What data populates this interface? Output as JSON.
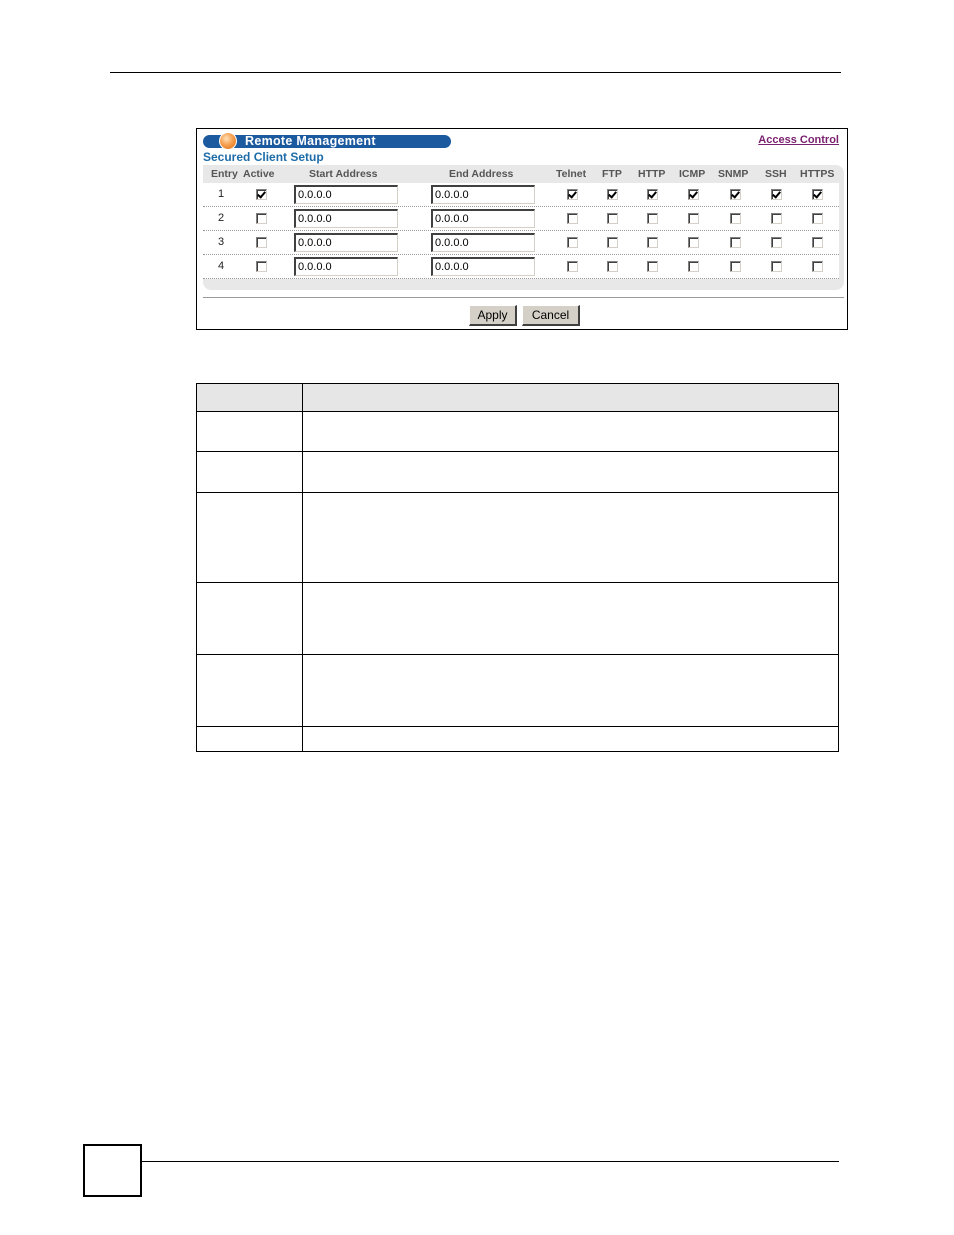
{
  "panel": {
    "title": "Remote Management",
    "link": "Access Control",
    "subtitle": "Secured Client Setup",
    "headers": {
      "entry": "Entry",
      "active": "Active",
      "start": "Start Address",
      "end": "End Address",
      "services": [
        "Telnet",
        "FTP",
        "HTTP",
        "ICMP",
        "SNMP",
        "SSH",
        "HTTPS"
      ]
    },
    "rows": [
      {
        "entry": "1",
        "active": true,
        "start": "0.0.0.0",
        "end": "0.0.0.0",
        "services": [
          true,
          true,
          true,
          true,
          true,
          true,
          true
        ]
      },
      {
        "entry": "2",
        "active": false,
        "start": "0.0.0.0",
        "end": "0.0.0.0",
        "services": [
          false,
          false,
          false,
          false,
          false,
          false,
          false
        ]
      },
      {
        "entry": "3",
        "active": false,
        "start": "0.0.0.0",
        "end": "0.0.0.0",
        "services": [
          false,
          false,
          false,
          false,
          false,
          false,
          false
        ]
      },
      {
        "entry": "4",
        "active": false,
        "start": "0.0.0.0",
        "end": "0.0.0.0",
        "services": [
          false,
          false,
          false,
          false,
          false,
          false,
          false
        ]
      }
    ],
    "buttons": {
      "apply": "Apply",
      "cancel": "Cancel"
    }
  },
  "description_table": {
    "rows": 7
  }
}
